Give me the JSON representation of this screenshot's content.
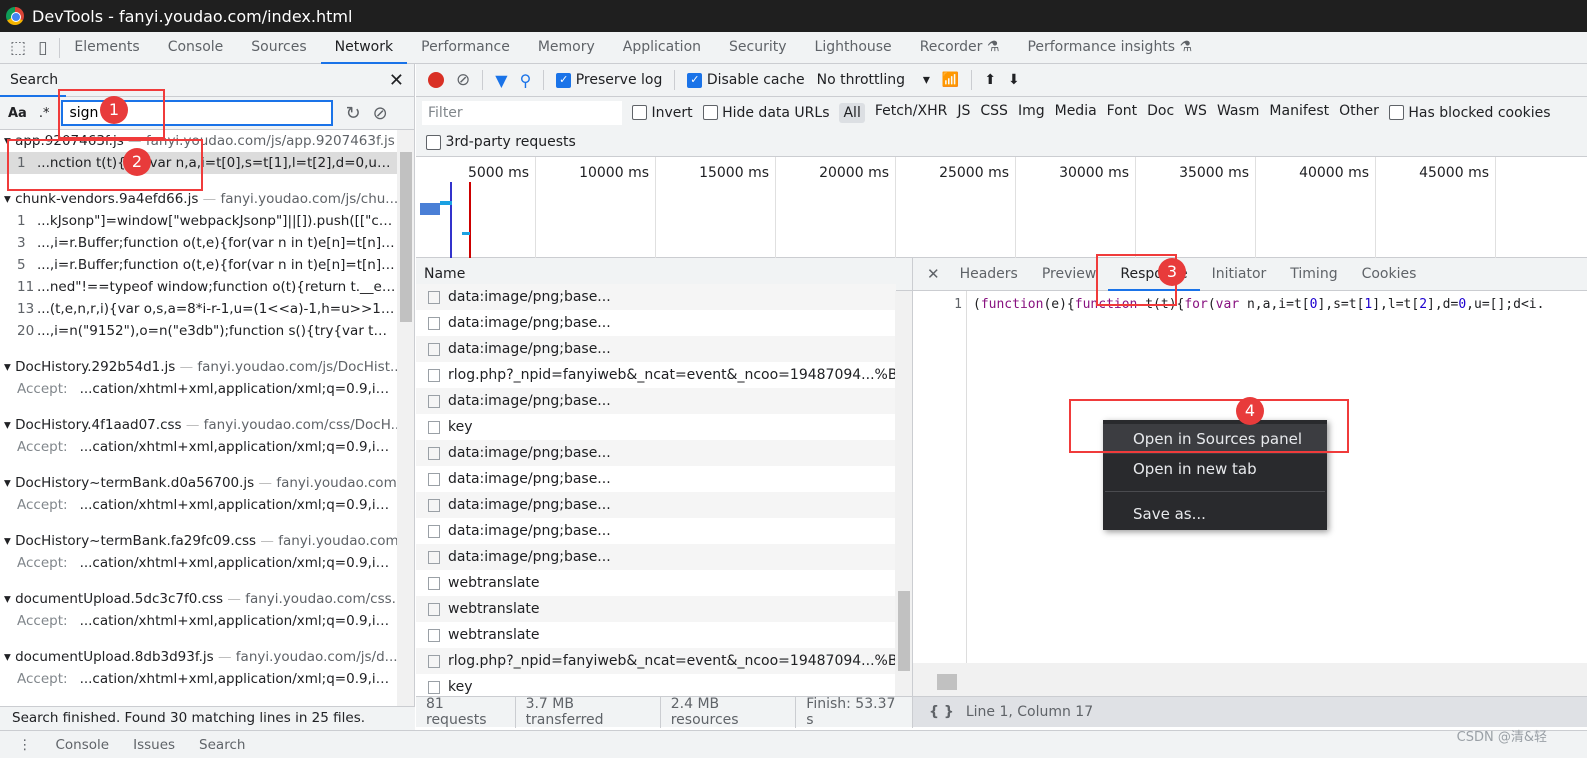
{
  "window": {
    "title": "DevTools - fanyi.youdao.com/index.html"
  },
  "main_tabs": [
    "Elements",
    "Console",
    "Sources",
    "Network",
    "Performance",
    "Memory",
    "Application",
    "Security",
    "Lighthouse",
    "Recorder ⚗",
    "Performance insights ⚗"
  ],
  "active_tab": "Network",
  "search": {
    "title": "Search",
    "case_label": "Aa",
    "regex_label": ".*",
    "query": "sign",
    "groups": [
      {
        "file": "app.9207463f.js",
        "url": "fanyi.youdao.com/js/app.9207463f.js",
        "lines": [
          {
            "no": "1",
            "text": "...nction t(t){for(var n,a,i=t[0],s=t[1],l=t[2],d=0,u=[];d<...",
            "selected": true
          }
        ]
      },
      {
        "file": "chunk-vendors.9a4efd66.js",
        "url": "fanyi.youdao.com/js/chu...",
        "lines": [
          {
            "no": "1",
            "text": "...kJsonp\"]=window[\"webpackJsonp\"]||[]).push([[\"chu..."
          },
          {
            "no": "3",
            "text": "...,i=r.Buffer;function o(t,e){for(var n in t)e[n]=t[n]}fun..."
          },
          {
            "no": "5",
            "text": "...,i=r.Buffer;function o(t,e){for(var n in t)e[n]=t[n]}fun..."
          },
          {
            "no": "11",
            "text": "...ned\"!==typeof window;function o(t){return t.__es..."
          },
          {
            "no": "13",
            "text": "...(t,e,n,r,i){var o,s,a=8*i-r-1,u=(1<<a)-1,h=u>>1,f=-..."
          },
          {
            "no": "20",
            "text": "...,i=n(\"9152\"),o=n(\"e3db\");function s(){try{var t=ne..."
          }
        ]
      },
      {
        "file": "DocHistory.292b54d1.js",
        "url": "fanyi.youdao.com/js/DocHist...",
        "accept": "...cation/xhtml+xml,application/xml;q=0.9,imag..."
      },
      {
        "file": "DocHistory.4f1aad07.css",
        "url": "fanyi.youdao.com/css/DocH...",
        "accept": "...cation/xhtml+xml,application/xml;q=0.9,imag..."
      },
      {
        "file": "DocHistory~termBank.d0a56700.js",
        "url": "fanyi.youdao.com...",
        "accept": "...cation/xhtml+xml,application/xml;q=0.9,imag..."
      },
      {
        "file": "DocHistory~termBank.fa29fc09.css",
        "url": "fanyi.youdao.com...",
        "accept": "...cation/xhtml+xml,application/xml;q=0.9,imag..."
      },
      {
        "file": "documentUpload.5dc3c7f0.css",
        "url": "fanyi.youdao.com/css...",
        "accept": "...cation/xhtml+xml,application/xml;q=0.9,imag..."
      },
      {
        "file": "documentUpload.8db3d93f.js",
        "url": "fanyi.youdao.com/js/d...",
        "accept": "...cation/xhtml+xml,application/xml;q=0.9,imag..."
      }
    ],
    "accept_label": "Accept:",
    "status": "Search finished.  Found 30 matching lines in 25 files."
  },
  "drawer_tabs": [
    "Console",
    "Issues",
    "Search"
  ],
  "network": {
    "preserve_log": "Preserve log",
    "disable_cache": "Disable cache",
    "throttling": "No throttling",
    "filter_placeholder": "Filter",
    "invert": "Invert",
    "hide_data_urls": "Hide data URLs",
    "types": [
      "All",
      "Fetch/XHR",
      "JS",
      "CSS",
      "Img",
      "Media",
      "Font",
      "Doc",
      "WS",
      "Wasm",
      "Manifest",
      "Other"
    ],
    "has_blocked": "Has blocked cookies",
    "third_party": "3rd-party requests",
    "ticks": [
      "5000 ms",
      "10000 ms",
      "15000 ms",
      "20000 ms",
      "25000 ms",
      "30000 ms",
      "35000 ms",
      "40000 ms",
      "45000 ms",
      "50"
    ],
    "name_header": "Name",
    "rows": [
      "data:image/png;base...",
      "data:image/png;base...",
      "data:image/png;base...",
      "rlog.php?_npid=fanyiweb&_ncat=event&_ncoo=19487094...%BA%E...",
      "data:image/png;base...",
      "key",
      "data:image/png;base...",
      "data:image/png;base...",
      "data:image/png;base...",
      "data:image/png;base...",
      "data:image/png;base...",
      "webtranslate",
      "webtranslate",
      "webtranslate",
      "rlog.php?_npid=fanyiweb&_ncat=event&_ncoo=19487094...%BA%E...",
      "key"
    ],
    "status": [
      "81 requests",
      "3.7 MB transferred",
      "2.4 MB resources",
      "Finish: 53.37 s"
    ]
  },
  "detail": {
    "tabs": [
      "Headers",
      "Preview",
      "Response",
      "Initiator",
      "Timing",
      "Cookies"
    ],
    "active": "Response",
    "line_no": "1",
    "cursor": "Line 1, Column 17"
  },
  "context_menu": [
    "Open in Sources panel",
    "Open in new tab",
    "Save as..."
  ],
  "annotations": [
    "1",
    "2",
    "3",
    "4"
  ],
  "watermark": "CSDN @清&轻",
  "colors": {
    "accent": "#1a73e8",
    "annotation": "#f03b3b",
    "record": "#d93025"
  }
}
